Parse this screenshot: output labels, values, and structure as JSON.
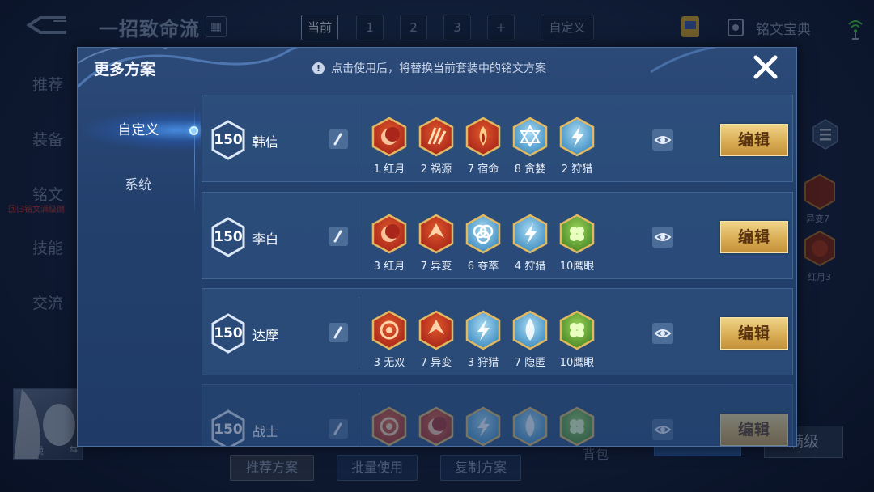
{
  "background": {
    "page_title": "一招致命流",
    "page_tabs": [
      "当前",
      "1",
      "2",
      "3",
      "+",
      "自定义"
    ],
    "codex_label": "铭文宝典",
    "left_nav": [
      "推荐",
      "装备",
      "铭文",
      "技能",
      "交流"
    ],
    "left_nav_sub": "回归铭文满级倒",
    "avatar_name": "镜",
    "bottom_buttons": [
      "推荐方案",
      "批量使用",
      "复制方案"
    ],
    "bag_label": "背包",
    "max_button": "满级",
    "side_runes": [
      "异变7",
      "红月3"
    ]
  },
  "modal": {
    "title": "更多方案",
    "info_text": "点击使用后，将替换当前套装中的铭文方案",
    "close_icon": "close-x-icon",
    "tabs": [
      {
        "label": "自定义",
        "active": true
      },
      {
        "label": "系统",
        "active": false
      }
    ],
    "rows": [
      {
        "level": "150",
        "hero": "韩信",
        "edit_label": "编辑",
        "runes": [
          {
            "label": "1 红月",
            "color": "red",
            "icon": "moon-rune-icon"
          },
          {
            "label": "2 祸源",
            "color": "red",
            "icon": "claw-rune-icon"
          },
          {
            "label": "7 宿命",
            "color": "red",
            "icon": "flame-rune-icon"
          },
          {
            "label": "8 贪婪",
            "color": "blue",
            "icon": "star-rune-icon"
          },
          {
            "label": "2 狩猎",
            "color": "blue",
            "icon": "lightning-rune-icon"
          }
        ]
      },
      {
        "level": "150",
        "hero": "李白",
        "edit_label": "编辑",
        "runes": [
          {
            "label": "3 红月",
            "color": "red",
            "icon": "moon-rune-icon"
          },
          {
            "label": "7 异变",
            "color": "red",
            "icon": "arrow-rune-icon"
          },
          {
            "label": "6 夺萃",
            "color": "blue",
            "icon": "knot-rune-icon"
          },
          {
            "label": "4 狩猎",
            "color": "blue",
            "icon": "lightning-rune-icon"
          },
          {
            "label": "10鹰眼",
            "color": "green",
            "icon": "clover-rune-icon"
          }
        ]
      },
      {
        "level": "150",
        "hero": "达摩",
        "edit_label": "编辑",
        "runes": [
          {
            "label": "3 无双",
            "color": "red",
            "icon": "swirl-rune-icon"
          },
          {
            "label": "7 异变",
            "color": "red",
            "icon": "arrow-rune-icon"
          },
          {
            "label": "3 狩猎",
            "color": "blue",
            "icon": "lightning-rune-icon"
          },
          {
            "label": "7 隐匿",
            "color": "blue",
            "icon": "drop-rune-icon"
          },
          {
            "label": "10鹰眼",
            "color": "green",
            "icon": "clover-rune-icon"
          }
        ]
      },
      {
        "level": "150",
        "hero": "战士",
        "edit_label": "编辑",
        "runes": [
          {
            "label": "",
            "color": "red",
            "icon": "swirl-rune-icon"
          },
          {
            "label": "",
            "color": "red",
            "icon": "moon-rune-icon"
          },
          {
            "label": "",
            "color": "blue",
            "icon": "lightning-rune-icon"
          },
          {
            "label": "",
            "color": "blue",
            "icon": "drop-rune-icon"
          },
          {
            "label": "",
            "color": "green",
            "icon": "clover-rune-icon"
          }
        ]
      }
    ]
  },
  "colors": {
    "modal_bg": "#23406d",
    "edit_button": "#d9ad55",
    "rune_red": "#c93a1e",
    "rune_blue": "#3a8fc9",
    "rune_green": "#5aa63a",
    "rune_gold_frame": "#e2b960"
  }
}
